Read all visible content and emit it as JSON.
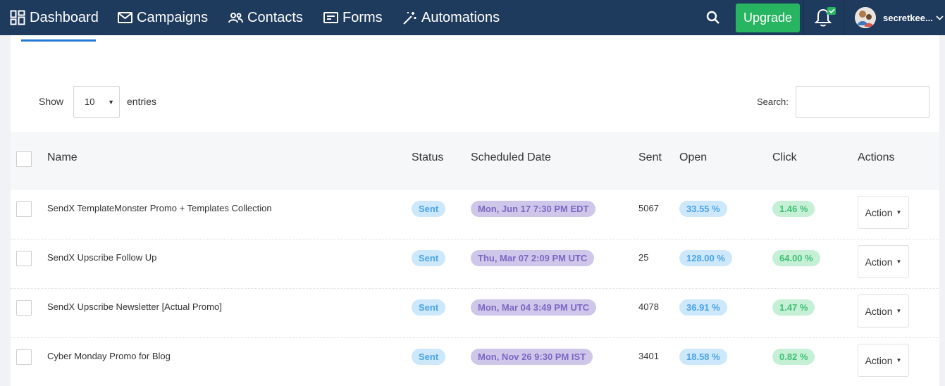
{
  "nav": {
    "dashboard": "Dashboard",
    "campaigns": "Campaigns",
    "contacts": "Contacts",
    "forms": "Forms",
    "automations": "Automations",
    "upgrade": "Upgrade",
    "username": "secretkee..."
  },
  "controls": {
    "show_label": "Show",
    "entries_value": "10",
    "entries_label": "entries",
    "search_label": "Search:"
  },
  "table": {
    "headers": {
      "name": "Name",
      "status": "Status",
      "scheduled": "Scheduled Date",
      "sent": "Sent",
      "open": "Open",
      "click": "Click",
      "actions": "Actions"
    },
    "action_label": "Action",
    "rows": [
      {
        "name": "SendX TemplateMonster Promo + Templates Collection",
        "status": "Sent",
        "date": "Mon, Jun 17 7:30 PM EDT",
        "sent": "5067",
        "open": "33.55 %",
        "click": "1.46 %"
      },
      {
        "name": "SendX Upscribe Follow Up",
        "status": "Sent",
        "date": "Thu, Mar 07 2:09 PM UTC",
        "sent": "25",
        "open": "128.00 %",
        "click": "64.00 %"
      },
      {
        "name": "SendX Upscribe Newsletter [Actual Promo]",
        "status": "Sent",
        "date": "Mon, Mar 04 3:49 PM UTC",
        "sent": "4078",
        "open": "36.91 %",
        "click": "1.47 %"
      },
      {
        "name": "Cyber Monday Promo for Blog",
        "status": "Sent",
        "date": "Mon, Nov 26 9:30 PM IST",
        "sent": "3401",
        "open": "18.58 %",
        "click": "0.82 %"
      }
    ]
  },
  "colors": {
    "nav_bg": "#1e3a5c",
    "upgrade": "#27b561",
    "accent": "#2478d6"
  }
}
